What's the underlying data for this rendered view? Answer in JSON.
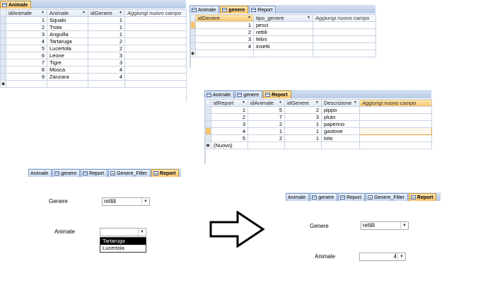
{
  "animale_table": {
    "tabs": [
      {
        "label": "Animale",
        "active": true
      }
    ],
    "columns": [
      "idAnimale",
      "Animale",
      "idGenere",
      "Aggiungi nuovo campo"
    ],
    "rows": [
      {
        "id": "1",
        "name": "Squalo",
        "genere": "1"
      },
      {
        "id": "2",
        "name": "Trota",
        "genere": "1"
      },
      {
        "id": "3",
        "name": "Anguilla",
        "genere": "1"
      },
      {
        "id": "4",
        "name": "Tartaruga",
        "genere": "2"
      },
      {
        "id": "5",
        "name": "Lucertola",
        "genere": "2"
      },
      {
        "id": "6",
        "name": "Leone",
        "genere": "3"
      },
      {
        "id": "7",
        "name": "Tigre",
        "genere": "3"
      },
      {
        "id": "8",
        "name": "Mosca",
        "genere": "4"
      },
      {
        "id": "9",
        "name": "Zanzara",
        "genere": "4"
      }
    ]
  },
  "genere_table": {
    "tabs": [
      {
        "label": "Animale"
      },
      {
        "label": "genere",
        "active": true
      },
      {
        "label": "Report"
      }
    ],
    "columns": [
      "idGenere",
      "tipo_genere",
      "Aggiungi nuovo campo"
    ],
    "rows": [
      {
        "id": "1",
        "tipo": "pesci"
      },
      {
        "id": "2",
        "tipo": "rettili"
      },
      {
        "id": "3",
        "tipo": "felini"
      },
      {
        "id": "4",
        "tipo": "insetti"
      }
    ]
  },
  "report_table": {
    "tabs": [
      {
        "label": "Animale"
      },
      {
        "label": "genere"
      },
      {
        "label": "Report",
        "active": true
      }
    ],
    "columns": [
      "idReport",
      "idAnimale",
      "idGenere",
      "Descrizione",
      "Aggiungi nuovo campo"
    ],
    "rows": [
      {
        "idReport": "1",
        "idAnimale": "5",
        "idGenere": "2",
        "descr": "pippo"
      },
      {
        "idReport": "2",
        "idAnimale": "7",
        "idGenere": "3",
        "descr": "pluto"
      },
      {
        "idReport": "3",
        "idAnimale": "2",
        "idGenere": "1",
        "descr": "paperino"
      },
      {
        "idReport": "4",
        "idAnimale": "1",
        "idGenere": "1",
        "descr": "gastone"
      },
      {
        "idReport": "5",
        "idAnimale": "2",
        "idGenere": "1",
        "descr": "toto"
      }
    ],
    "new_row_label": "(Nuovo)"
  },
  "form_before": {
    "tabs": [
      {
        "label": "Animale"
      },
      {
        "label": "genere"
      },
      {
        "label": "Report"
      },
      {
        "label": "Genere_Filter"
      },
      {
        "label": "Report",
        "active": true
      }
    ],
    "genere_label": "Genere",
    "genere_value": "rettili",
    "animale_label": "Animale",
    "animale_value": "",
    "dropdown_options": [
      "Tartaruga",
      "Lucertola"
    ]
  },
  "form_after": {
    "tabs": [
      {
        "label": "Animale"
      },
      {
        "label": "genere"
      },
      {
        "label": "Report"
      },
      {
        "label": "Genere_Filter"
      },
      {
        "label": "Report",
        "active": true
      }
    ],
    "genere_label": "Genere",
    "genere_value": "rettili",
    "animale_label": "Animale",
    "animale_value": "4"
  },
  "icons": {
    "new_record": "new-record-icon",
    "current_record": "current-record-pencil-icon",
    "dropdown": "chevron-down-icon",
    "arrow": "right-arrow-icon"
  },
  "colors": {
    "active_tab": "#f7c46a",
    "tab_strip": "#b7cbe6",
    "grid_header": "#dfe7f2",
    "selected_row": "#f7c46a",
    "focus_border": "#e59a33"
  }
}
